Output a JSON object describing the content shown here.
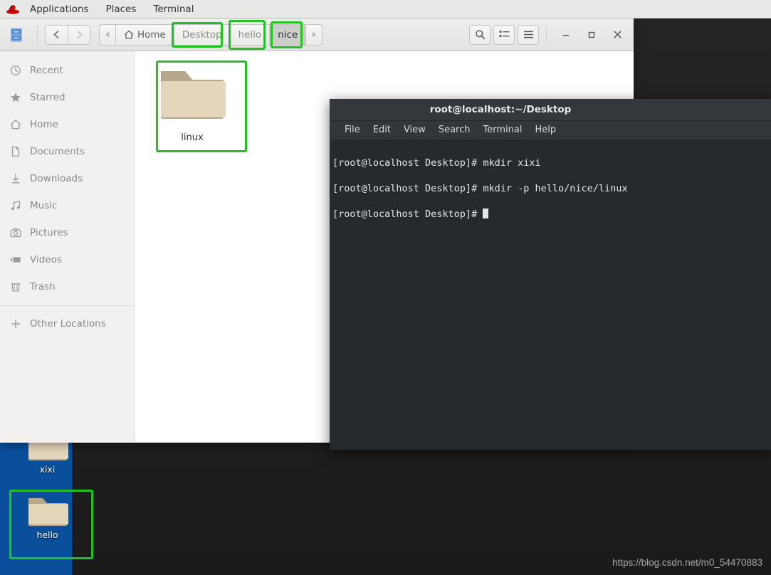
{
  "top_panel": {
    "logo_icon": "redhat-logo-icon",
    "items": [
      {
        "label": "Applications"
      },
      {
        "label": "Places"
      },
      {
        "label": "Terminal"
      }
    ]
  },
  "files_window": {
    "app_icon": "file-cabinet-icon",
    "nav": {
      "back_icon": "chevron-left-icon",
      "forward_icon": "chevron-right-icon"
    },
    "breadcrumb": {
      "left_arrow_icon": "triangle-left-icon",
      "right_arrow_icon": "triangle-right-icon",
      "home_icon": "home-icon",
      "items": [
        {
          "label": "Home",
          "active": false,
          "highlighted": false
        },
        {
          "label": "Desktop",
          "active": false,
          "highlighted": true
        },
        {
          "label": "hello",
          "active": false,
          "highlighted": true
        },
        {
          "label": "nice",
          "active": true,
          "highlighted": true
        }
      ]
    },
    "toolbar": {
      "search_icon": "search-icon",
      "view_list_icon": "list-view-icon",
      "menu_icon": "hamburger-menu-icon"
    },
    "window_controls": {
      "minimize_label": "–",
      "maximize_label": "□",
      "close_label": "×"
    },
    "sidebar": {
      "items": [
        {
          "label": "Recent",
          "icon": "clock-icon"
        },
        {
          "label": "Starred",
          "icon": "star-icon"
        },
        {
          "label": "Home",
          "icon": "home-icon"
        },
        {
          "label": "Documents",
          "icon": "document-icon"
        },
        {
          "label": "Downloads",
          "icon": "download-arrow-icon"
        },
        {
          "label": "Music",
          "icon": "music-note-icon"
        },
        {
          "label": "Pictures",
          "icon": "camera-icon"
        },
        {
          "label": "Videos",
          "icon": "video-icon"
        },
        {
          "label": "Trash",
          "icon": "trash-icon"
        }
      ],
      "other_locations": {
        "label": "Other Locations",
        "icon": "plus-icon"
      }
    },
    "files": [
      {
        "name": "linux",
        "type": "folder",
        "highlighted": true
      }
    ]
  },
  "terminal": {
    "title": "root@localhost:~/Desktop",
    "menu": [
      {
        "label": "File"
      },
      {
        "label": "Edit"
      },
      {
        "label": "View"
      },
      {
        "label": "Search"
      },
      {
        "label": "Terminal"
      },
      {
        "label": "Help"
      }
    ],
    "lines": [
      "[root@localhost Desktop]# mkdir xixi",
      "[root@localhost Desktop]# mkdir -p hello/nice/linux"
    ],
    "prompt": "[root@localhost Desktop]# "
  },
  "desktop": {
    "icons": [
      {
        "name": "xixi",
        "selected": true,
        "highlighted": false
      },
      {
        "name": "hello",
        "selected": true,
        "highlighted": true
      }
    ]
  },
  "watermark": "https://blog.csdn.net/m0_54470883",
  "colors": {
    "annotation_green": "#22c024",
    "selection_blue": "#0a4f9c",
    "terminal_bg": "#262a2d",
    "panel_bg": "#e8e8e7"
  }
}
